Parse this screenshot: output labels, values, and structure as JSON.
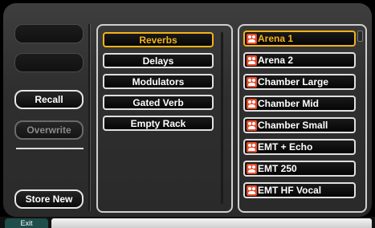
{
  "side": {
    "empty_slots": [
      "",
      ""
    ],
    "recall_label": "Recall",
    "overwrite_label": "Overwrite",
    "store_new_label": "Store New"
  },
  "categories": {
    "items": [
      "Reverbs",
      "Delays",
      "Modulators",
      "Gated Verb",
      "Empty Rack"
    ],
    "selected": "Reverbs"
  },
  "presets": {
    "items": [
      "Arena 1",
      "Arena 2",
      "Chamber Large",
      "Chamber Mid",
      "Chamber Small",
      "EMT + Echo",
      "EMT 250",
      "EMT HF Vocal"
    ],
    "selected": "Arena 1",
    "icon": "preset-people-icon"
  },
  "footer": {
    "exit_label": "Exit"
  },
  "colors": {
    "accent": "#f3b21a",
    "preset_icon": "#e84a2a",
    "exit_tab": "#1f4e4a"
  }
}
